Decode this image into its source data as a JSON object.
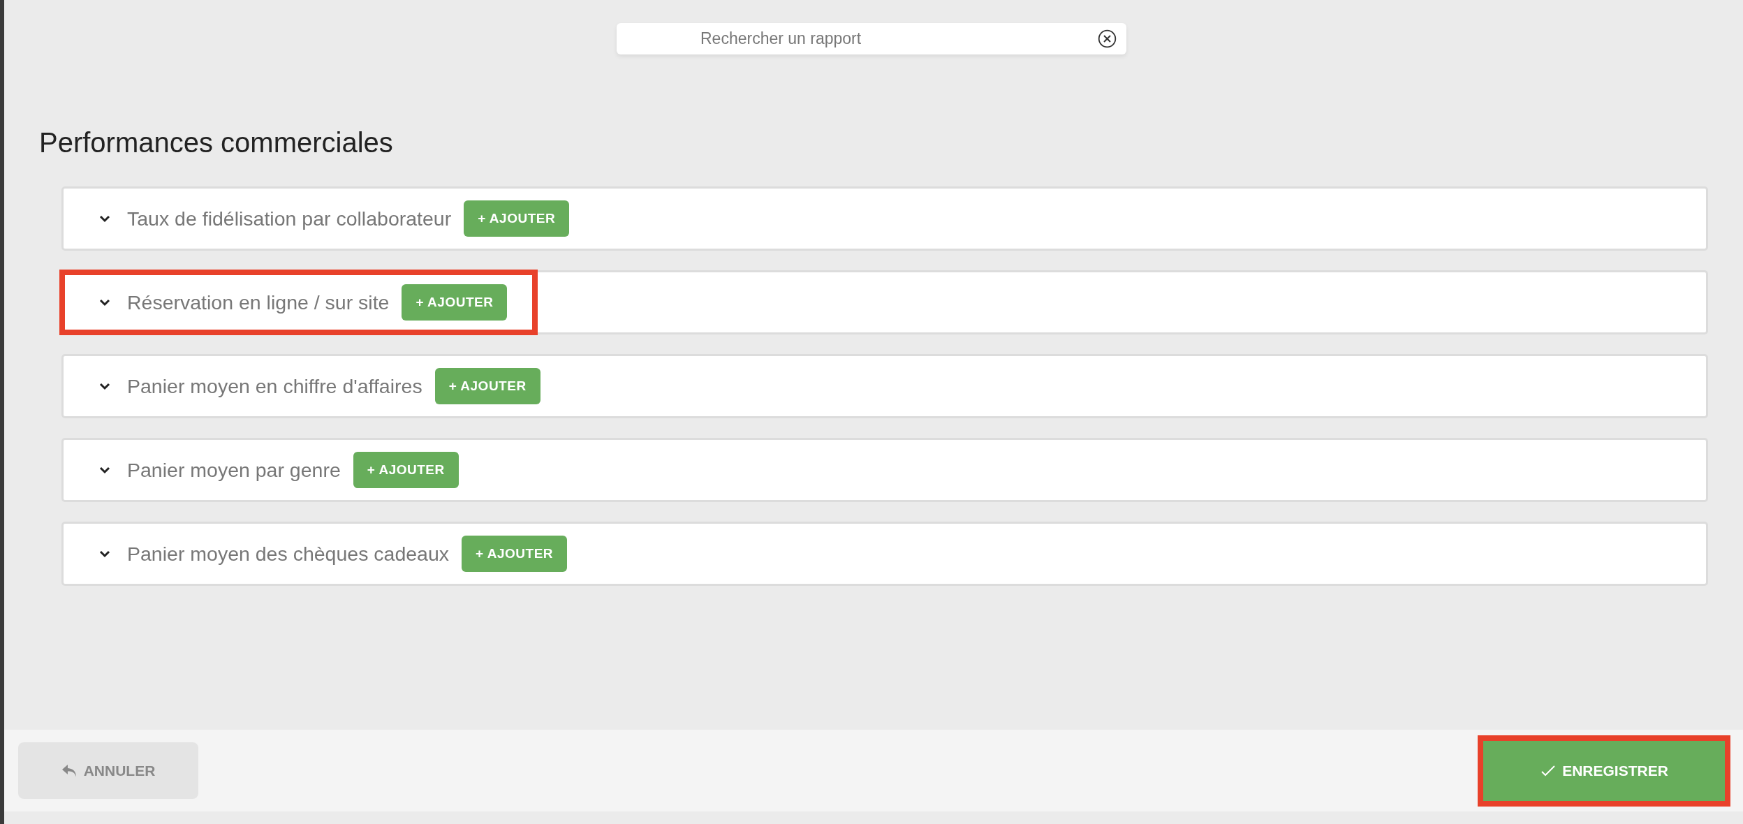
{
  "search": {
    "placeholder": "Rechercher un rapport"
  },
  "section": {
    "title": "Performances commerciales"
  },
  "reports": [
    {
      "title": "Taux de fidélisation par collaborateur",
      "expanded": false,
      "highlighted": false,
      "add_label": "+ AJOUTER"
    },
    {
      "title": "Réservation en ligne / sur site",
      "expanded": false,
      "highlighted": true,
      "add_label": "+ AJOUTER"
    },
    {
      "title": "Panier moyen en chiffre d'affaires",
      "expanded": false,
      "highlighted": false,
      "add_label": "+ AJOUTER"
    },
    {
      "title": "Panier moyen par genre",
      "expanded": false,
      "highlighted": false,
      "add_label": "+ AJOUTER"
    },
    {
      "title": "Panier moyen des chèques cadeaux",
      "expanded": false,
      "highlighted": false,
      "add_label": "+ AJOUTER"
    }
  ],
  "footer": {
    "cancel": {
      "label": "ANNULER",
      "disabled": true
    },
    "save": {
      "label": "ENREGISTRER",
      "highlighted": true
    }
  }
}
